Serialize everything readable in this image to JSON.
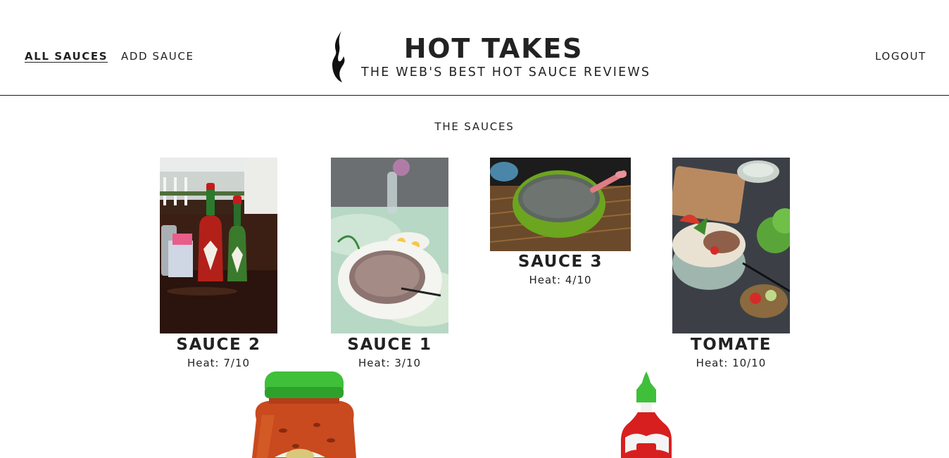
{
  "nav": {
    "all_sauces": "ALL SAUCES",
    "add_sauce": "ADD SAUCE",
    "logout": "LOGOUT"
  },
  "brand": {
    "title": "HOT TAKES",
    "tagline": "THE WEB'S BEST HOT SAUCE REVIEWS",
    "logo_icon": "flame-icon"
  },
  "section_title": "THE SAUCES",
  "heat_prefix": "Heat:",
  "sauces": [
    {
      "name": "SAUCE 2",
      "heat": "Heat: 7/10",
      "image": "tabasco-bottles-photo"
    },
    {
      "name": "SAUCE 1",
      "heat": "Heat: 3/10",
      "image": "porridge-bowl-photo"
    },
    {
      "name": "SAUCE 3",
      "heat": "Heat: 4/10",
      "image": "green-bowl-soup-photo"
    },
    {
      "name": "TOMATE",
      "heat": "Heat: 10/10",
      "image": "noodle-soup-photo"
    }
  ],
  "decorations": [
    "salsa-jar-illustration",
    "sriracha-bottle-illustration"
  ],
  "colors": {
    "text": "#222222",
    "divider": "#1a1a1a",
    "background": "#ffffff",
    "jar_lid": "#3fbf3a",
    "sriracha_red": "#d81f1f"
  }
}
